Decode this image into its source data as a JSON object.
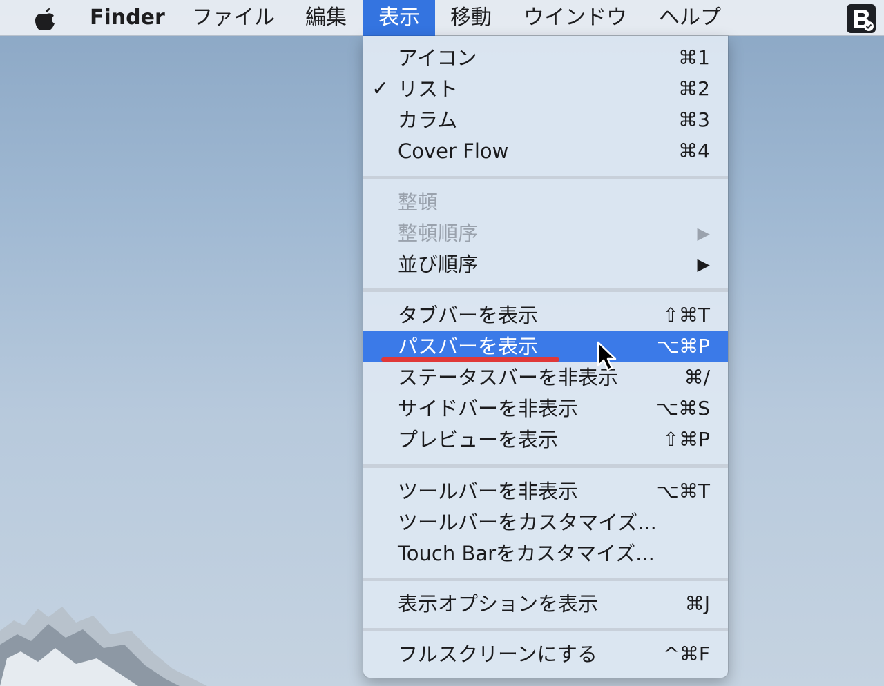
{
  "menubar": {
    "app_name": "Finder",
    "items": [
      "ファイル",
      "編集",
      "表示",
      "移動",
      "ウインドウ",
      "ヘルプ"
    ],
    "active_item": "表示"
  },
  "menu": {
    "groups": [
      [
        {
          "label": "アイコン",
          "shortcut": "⌘1"
        },
        {
          "label": "リスト",
          "shortcut": "⌘2",
          "checked": true
        },
        {
          "label": "カラム",
          "shortcut": "⌘3"
        },
        {
          "label": "Cover Flow",
          "shortcut": "⌘4"
        }
      ],
      [
        {
          "label": "整頓",
          "disabled": true
        },
        {
          "label": "整頓順序",
          "submenu": true,
          "disabled": true
        },
        {
          "label": "並び順序",
          "submenu": true
        }
      ],
      [
        {
          "label": "タブバーを表示",
          "shortcut": "⇧⌘T"
        },
        {
          "label": "パスバーを表示",
          "shortcut": "⌥⌘P",
          "highlighted": true
        },
        {
          "label": "ステータスバーを非表示",
          "shortcut": "⌘/"
        },
        {
          "label": "サイドバーを非表示",
          "shortcut": "⌥⌘S"
        },
        {
          "label": "プレビューを表示",
          "shortcut": "⇧⌘P"
        }
      ],
      [
        {
          "label": "ツールバーを非表示",
          "shortcut": "⌥⌘T"
        },
        {
          "label": "ツールバーをカスタマイズ..."
        },
        {
          "label": "Touch Barをカスタマイズ..."
        }
      ],
      [
        {
          "label": "表示オプションを表示",
          "shortcut": "⌘J"
        }
      ],
      [
        {
          "label": "フルスクリーンにする",
          "shortcut": "^⌘F"
        }
      ]
    ],
    "check_glyph": "✓",
    "submenu_glyph": "▶"
  },
  "colors": {
    "highlight": "#3b7ae8",
    "annotation_underline": "#e03838"
  }
}
